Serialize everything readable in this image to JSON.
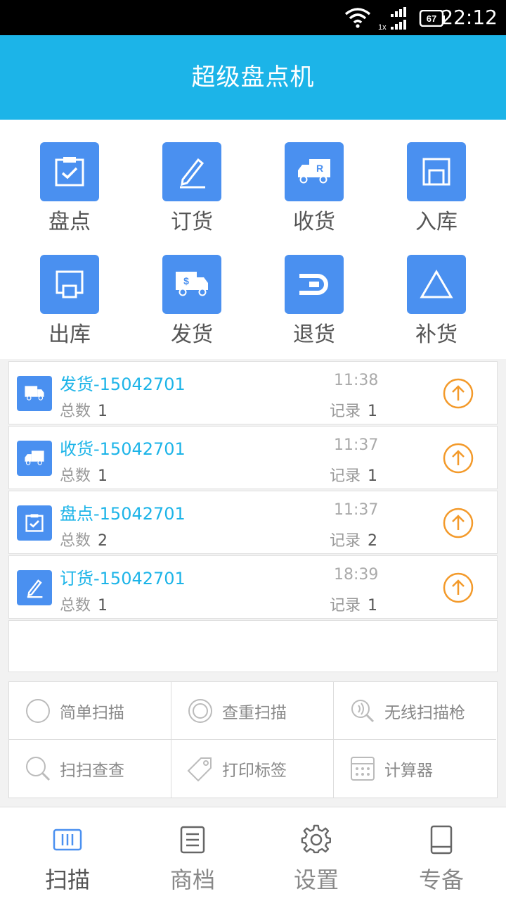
{
  "status": {
    "time": "22:12",
    "battery": "67",
    "signal_label": "1x"
  },
  "app": {
    "title": "超级盘点机"
  },
  "features": [
    {
      "label": "盘点",
      "icon": "inventory-check-icon"
    },
    {
      "label": "订货",
      "icon": "pen-order-icon"
    },
    {
      "label": "收货",
      "icon": "receive-truck-icon"
    },
    {
      "label": "入库",
      "icon": "stock-in-icon"
    },
    {
      "label": "出库",
      "icon": "stock-out-icon"
    },
    {
      "label": "发货",
      "icon": "ship-truck-icon"
    },
    {
      "label": "退货",
      "icon": "return-icon"
    },
    {
      "label": "补货",
      "icon": "triangle-icon"
    }
  ],
  "records": [
    {
      "title": "发货-15042701",
      "count_label": "总数",
      "count": "1",
      "time": "11:38",
      "rec_label": "记录",
      "rec": "1",
      "icon": "ship-truck-icon"
    },
    {
      "title": "收货-15042701",
      "count_label": "总数",
      "count": "1",
      "time": "11:37",
      "rec_label": "记录",
      "rec": "1",
      "icon": "receive-truck-icon"
    },
    {
      "title": "盘点-15042701",
      "count_label": "总数",
      "count": "2",
      "time": "11:37",
      "rec_label": "记录",
      "rec": "2",
      "icon": "inventory-check-icon"
    },
    {
      "title": "订货-15042701",
      "count_label": "总数",
      "count": "1",
      "time": "18:39",
      "rec_label": "记录",
      "rec": "1",
      "icon": "pen-order-icon"
    }
  ],
  "tools": [
    {
      "label": "简单扫描",
      "icon": "circle-icon"
    },
    {
      "label": "查重扫描",
      "icon": "double-circle-icon"
    },
    {
      "label": "无线扫描枪",
      "icon": "wireless-scan-icon"
    },
    {
      "label": "扫扫查查",
      "icon": "magnifier-icon"
    },
    {
      "label": "打印标签",
      "icon": "tag-icon"
    },
    {
      "label": "计算器",
      "icon": "calculator-icon"
    }
  ],
  "tabs": [
    {
      "label": "扫描",
      "icon": "barcode-icon",
      "active": true
    },
    {
      "label": "商档",
      "icon": "list-doc-icon",
      "active": false
    },
    {
      "label": "设置",
      "icon": "gear-icon",
      "active": false
    },
    {
      "label": "专备",
      "icon": "book-icon",
      "active": false
    }
  ],
  "colors": {
    "primary": "#1cb4e8",
    "tile": "#4a90f0",
    "upload": "#f39a2b",
    "active_tab": "#4a90f0"
  }
}
